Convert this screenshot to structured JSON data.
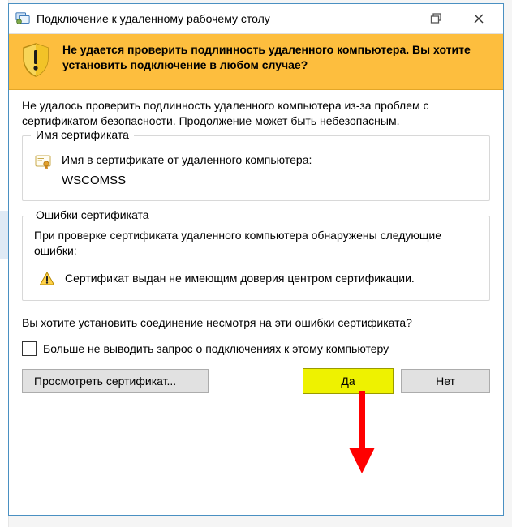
{
  "titlebar": {
    "title": "Подключение к удаленному рабочему столу"
  },
  "banner": {
    "message": "Не удается проверить подлинность удаленного компьютера. Вы хотите установить подключение в любом случае?"
  },
  "intro": "Не удалось проверить подлинность удаленного компьютера из-за проблем с сертификатом безопасности. Продолжение может быть небезопасным.",
  "cert_group": {
    "legend": "Имя сертификата",
    "label": "Имя в сертификате от удаленного компьютера:",
    "name": "WSCOMSS"
  },
  "error_group": {
    "legend": "Ошибки сертификата",
    "intro": "При проверке сертификата удаленного компьютера обнаружены следующие ошибки:",
    "item": "Сертификат выдан не имеющим доверия центром сертификации."
  },
  "question": "Вы хотите установить соединение несмотря на эти ошибки сертификата?",
  "checkbox": {
    "label": "Больше не выводить запрос о подключениях к этому компьютеру"
  },
  "buttons": {
    "view": "Просмотреть сертификат...",
    "yes": "Да",
    "no": "Нет"
  }
}
